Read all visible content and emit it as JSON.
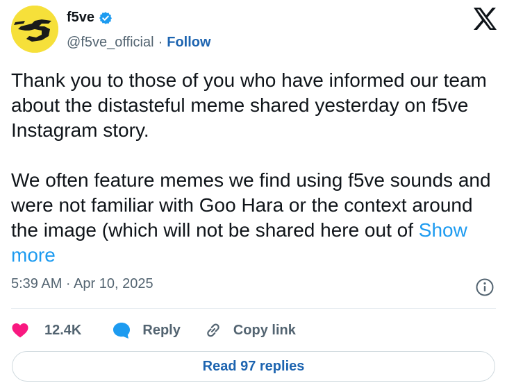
{
  "author": {
    "display_name": "f5ve",
    "handle": "@f5ve_official",
    "follow_label": "Follow",
    "verified": true,
    "avatar_icon": "f5ve-logo-icon"
  },
  "tweet": {
    "text": "Thank you to those of you who have informed our team about the distasteful meme shared yesterday on f5ve Instagram story.\n\nWe often feature memes we find using f5ve sounds and were not familiar with Goo Hara or the context around the image (which will not be shared here out of ",
    "show_more_label": "Show more",
    "timestamp": "5:39 AM · Apr 10, 2025"
  },
  "actions": {
    "like_count": "12.4K",
    "reply_label": "Reply",
    "copy_link_label": "Copy link",
    "read_replies_label": "Read 97 replies"
  },
  "colors": {
    "like": "#f91880",
    "reply": "#1d9bf0",
    "link": "#1d64b0",
    "show_more": "#1d9bf0",
    "verified": "#1d9bf0",
    "avatar_bg": "#f6e03a"
  }
}
